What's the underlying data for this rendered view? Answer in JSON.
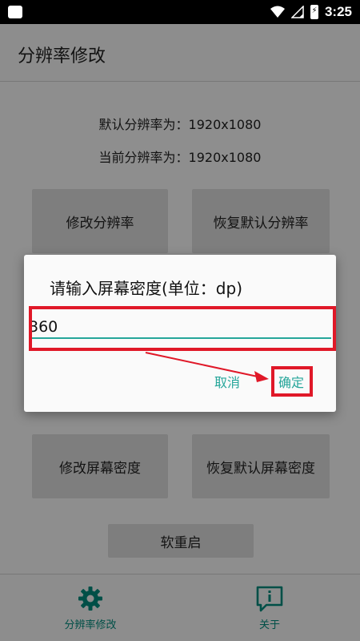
{
  "status_bar": {
    "time": "3:25"
  },
  "app_bar": {
    "title": "分辨率修改"
  },
  "info": {
    "default_resolution": "默认分辨率为：1920x1080",
    "current_resolution": "当前分辨率为：1920x1080"
  },
  "buttons": {
    "modify_resolution": "修改分辨率",
    "restore_resolution": "恢复默认分辨率",
    "modify_density": "修改屏幕密度",
    "restore_density": "恢复默认屏幕密度",
    "soft_reboot": "软重启"
  },
  "dialog": {
    "title": "请输入屏幕密度(单位：dp)",
    "input_value": "360",
    "cancel_label": "取消",
    "ok_label": "确定"
  },
  "bottom_nav": {
    "items": [
      {
        "label": "分辨率修改",
        "icon": "gear-icon",
        "active": true
      },
      {
        "label": "关于",
        "icon": "info-chat-icon",
        "active": false
      }
    ]
  },
  "colors": {
    "accent": "#26a69a",
    "annotation": "#e01828",
    "status_bar": "#000000"
  }
}
